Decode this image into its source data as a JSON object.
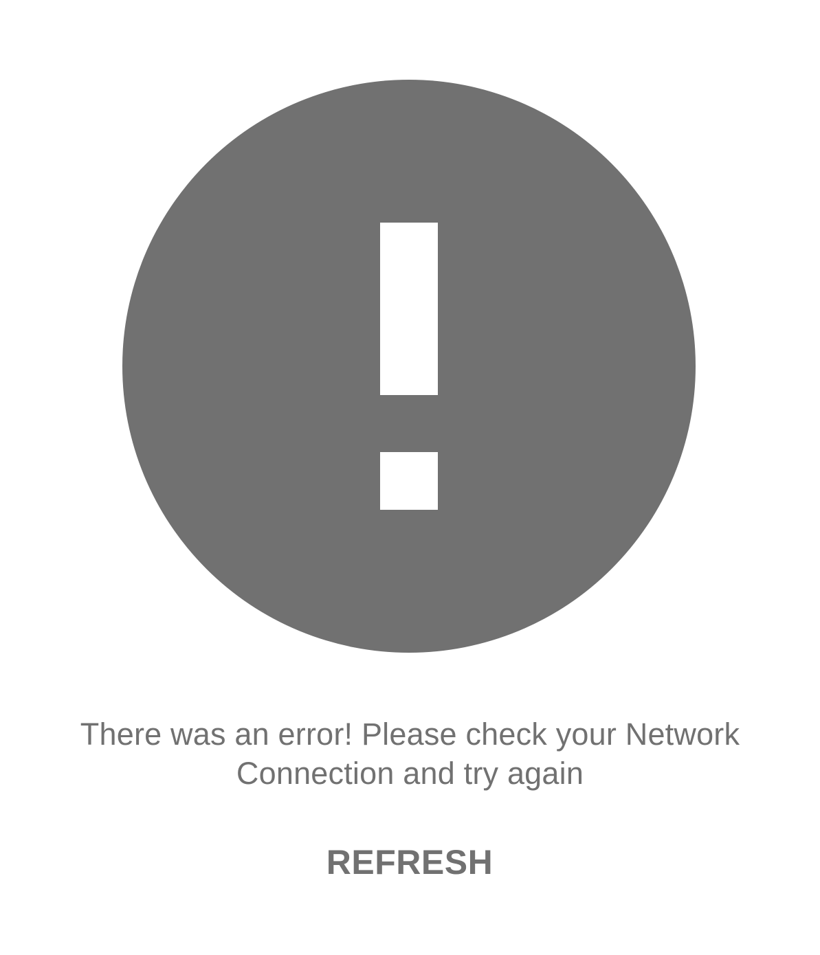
{
  "error": {
    "icon": "exclamation-circle-icon",
    "icon_color": "#717171",
    "message": "There was an error! Please check your Network Connection and try again",
    "refresh_label": "REFRESH",
    "text_color": "#717171"
  }
}
